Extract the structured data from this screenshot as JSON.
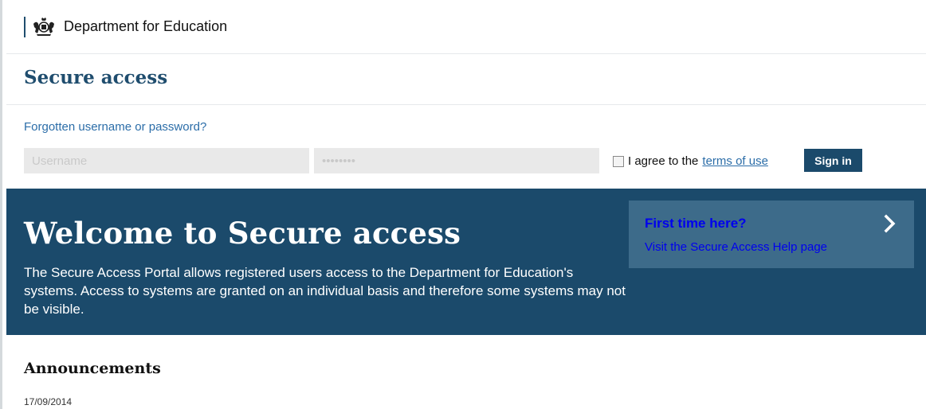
{
  "header": {
    "brand_name": "Department for Education",
    "crest_icon": "royal-crest-icon"
  },
  "page_title": "Secure access",
  "login": {
    "forgot_link": "Forgotten username or password?",
    "username_placeholder": "Username",
    "password_placeholder": "••••••••",
    "agree_text": "I agree to the",
    "terms_link": "terms of use",
    "agree_checked": false,
    "signin_label": "Sign in"
  },
  "hero": {
    "heading": "Welcome to Secure access",
    "body": "The Secure Access Portal allows registered users access to the Department for Education's systems. Access to systems are granted on an individual basis and therefore some systems may not be visible.",
    "first_time": {
      "title": "First time here?",
      "subtitle": "Visit the Secure Access Help page",
      "icon": "chevron-right-icon"
    }
  },
  "announcements": {
    "heading": "Announcements",
    "items": [
      {
        "date": "17/09/2014"
      }
    ]
  },
  "colors": {
    "primary_dark": "#1b4a6b",
    "panel": "#3d6b8a",
    "link": "#2b6da8",
    "title": "#1f4d6e"
  }
}
